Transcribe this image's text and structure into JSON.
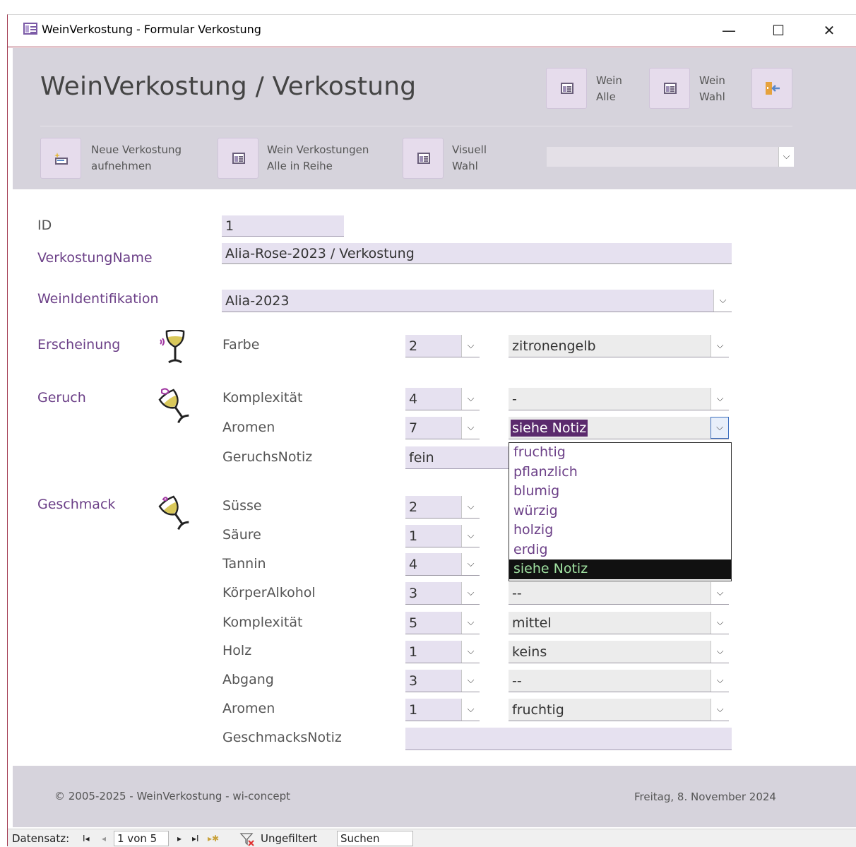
{
  "window": {
    "title": "WeinVerkostung - Formular Verkostung",
    "minimize": "—",
    "maximize": "☐",
    "close": "✕"
  },
  "header": {
    "title": "WeinVerkostung / Verkostung",
    "buttons": {
      "wein_alle": {
        "line1": "Wein",
        "line2": "Alle"
      },
      "wein_wahl": {
        "line1": "Wein",
        "line2": "Wahl"
      },
      "neue_verkostung": {
        "line1": "Neue Verkostung",
        "line2": "aufnehmen"
      },
      "wein_verkostungen": {
        "line1": "Wein Verkostungen",
        "line2": "Alle in Reihe"
      },
      "visuell_wahl": {
        "line1": "Visuell",
        "line2": "Wahl"
      }
    },
    "search_combo_value": ""
  },
  "form": {
    "id_label": "ID",
    "id_value": "1",
    "name_label": "VerkostungName",
    "name_value": "Alia-Rose-2023 / Verkostung",
    "wein_label": "WeinIdentifikation",
    "wein_value": "Alia-2023",
    "erscheinung": {
      "label": "Erscheinung",
      "farbe_label": "Farbe",
      "farbe_num": "2",
      "farbe_text": "zitronengelb"
    },
    "geruch": {
      "label": "Geruch",
      "komplexitaet_label": "Komplexität",
      "komplexitaet_num": "4",
      "komplexitaet_text": "-",
      "aromen_label": "Aromen",
      "aromen_num": "7",
      "aromen_text": "siehe Notiz",
      "notiz_label": "GeruchsNotiz",
      "notiz_value": "fein",
      "aromen_options": [
        "fruchtig",
        "pflanzlich",
        "blumig",
        "würzig",
        "holzig",
        "erdig",
        "siehe Notiz"
      ]
    },
    "geschmack": {
      "label": "Geschmack",
      "suesse_label": "Süsse",
      "suesse_num": "2",
      "saeure_label": "Säure",
      "saeure_num": "1",
      "tannin_label": "Tannin",
      "tannin_num": "4",
      "koerper_label": "KörperAlkohol",
      "koerper_num": "3",
      "koerper_text": "--",
      "komplexitaet_label": "Komplexität",
      "komplexitaet_num": "5",
      "komplexitaet_text": "mittel",
      "holz_label": "Holz",
      "holz_num": "1",
      "holz_text": "keins",
      "abgang_label": "Abgang",
      "abgang_num": "3",
      "abgang_text": "--",
      "aromen_label": "Aromen",
      "aromen_num": "1",
      "aromen_text": "fruchtig",
      "notiz_label": "GeschmacksNotiz",
      "notiz_value": ""
    }
  },
  "footer": {
    "copyright": "© 2005-2025 - WeinVerkostung - wi-concept",
    "date": "Freitag, 8. November 2024"
  },
  "navbar": {
    "label": "Datensatz:",
    "first": "I◂",
    "prev": "◂",
    "record": "1 von 5",
    "next": "▸",
    "last": "▸I",
    "new": "▸✱",
    "filter": "Ungefiltert",
    "search": "Suchen"
  },
  "colors": {
    "header_bg": "#d6d3dc",
    "label_purple": "#6b3f87",
    "window_border": "#a33c52",
    "selected_item_bg": "#111111"
  },
  "icons": {
    "dropdown": "⌵"
  }
}
